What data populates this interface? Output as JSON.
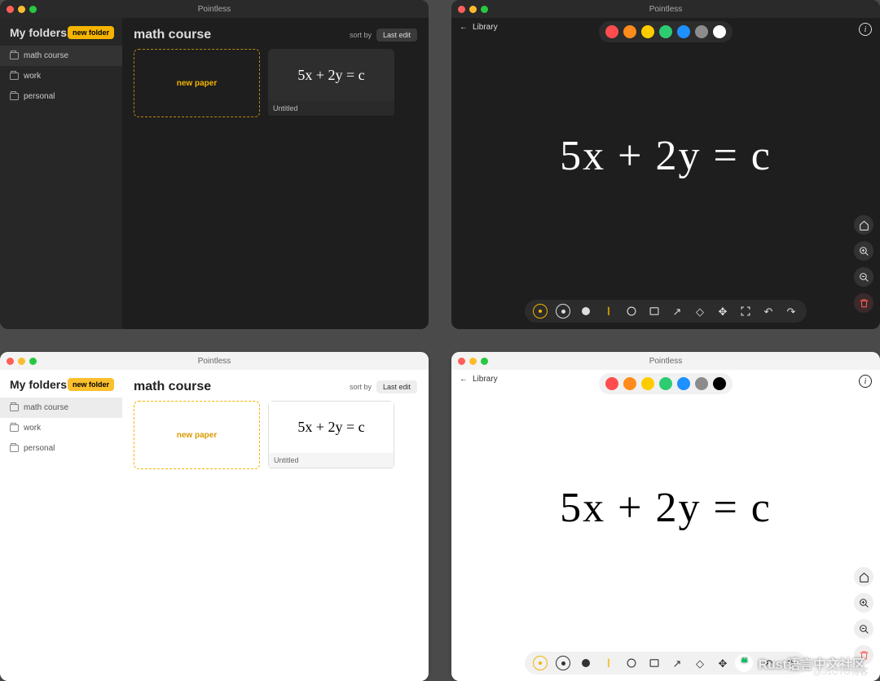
{
  "app_title": "Pointless",
  "library": {
    "sidebar_title": "My folders",
    "new_folder_btn": "new folder",
    "folders": [
      "math course",
      "work",
      "personal"
    ],
    "active_folder_index": 0,
    "heading": "math course",
    "sort_label": "sort by",
    "sort_value": "Last edit",
    "new_paper_label": "new paper",
    "paper_preview_text": "5x + 2y = c",
    "paper_caption": "Untitled"
  },
  "canvas": {
    "back_label": "Library",
    "palette": [
      "#ff4d4f",
      "#ff8c1a",
      "#ffcc00",
      "#2ecc71",
      "#1e90ff",
      "#8c8c8c"
    ],
    "equation": "5x + 2y = c",
    "side_tools": [
      "home",
      "zoom-in",
      "zoom-out",
      "trash"
    ],
    "toolbar": [
      "brush-small",
      "brush-medium",
      "brush-large",
      "scribble",
      "circle",
      "rect",
      "arrow",
      "eraser",
      "move",
      "fit",
      "undo",
      "redo"
    ]
  },
  "watermark": "Rust语言中文社区",
  "attribution": "@51CTO博客"
}
